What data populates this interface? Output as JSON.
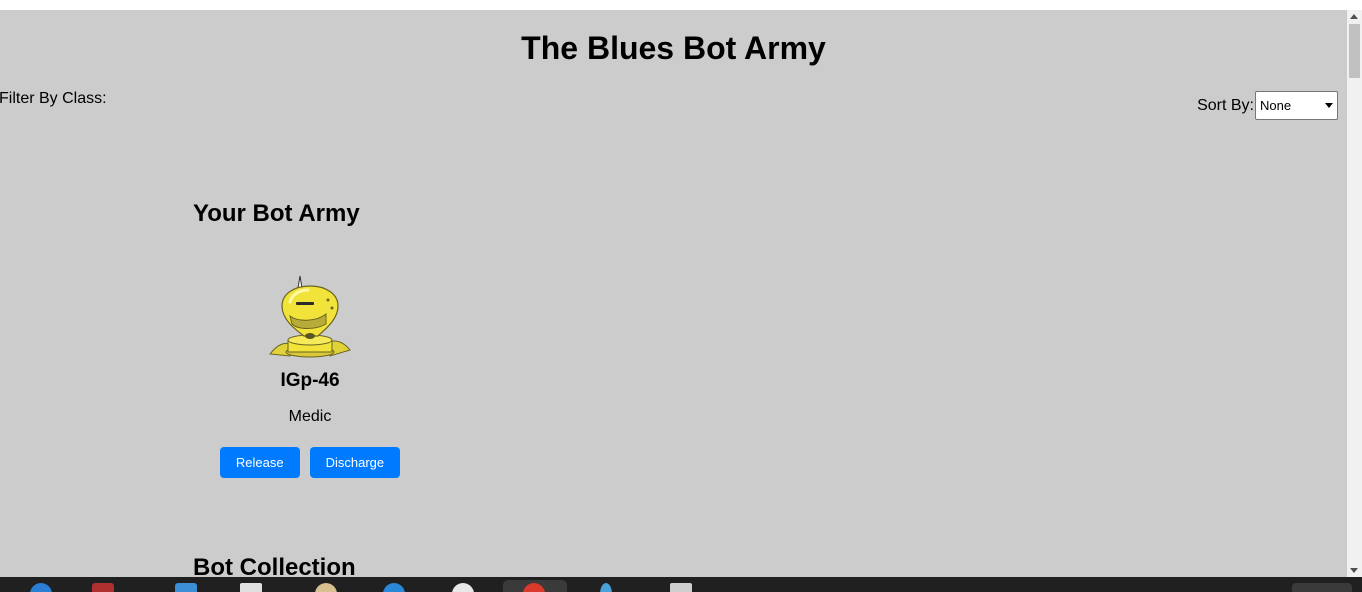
{
  "page": {
    "title": "The Blues Bot Army",
    "filter_label": "Filter By Class:",
    "sort_label": "Sort By:",
    "sort_selected": "None"
  },
  "army": {
    "heading": "Your Bot Army",
    "bots": [
      {
        "name": "IGp-46",
        "bot_class": "Medic",
        "release_label": "Release",
        "discharge_label": "Discharge",
        "avatar": "yellow-robot-avatar"
      }
    ]
  },
  "collection": {
    "heading": "Bot Collection"
  },
  "colors": {
    "page_background": "#cccccc",
    "button_primary": "#007bff",
    "button_text": "#ffffff",
    "robot_yellow": "#f2e33a"
  },
  "taskbar": {
    "icons": [
      "edge-icon",
      "app-icon",
      "explorer-icon",
      "file-icon",
      "app-icon",
      "app-icon",
      "app-icon",
      "chrome-icon",
      "app-icon",
      "app-icon"
    ]
  }
}
